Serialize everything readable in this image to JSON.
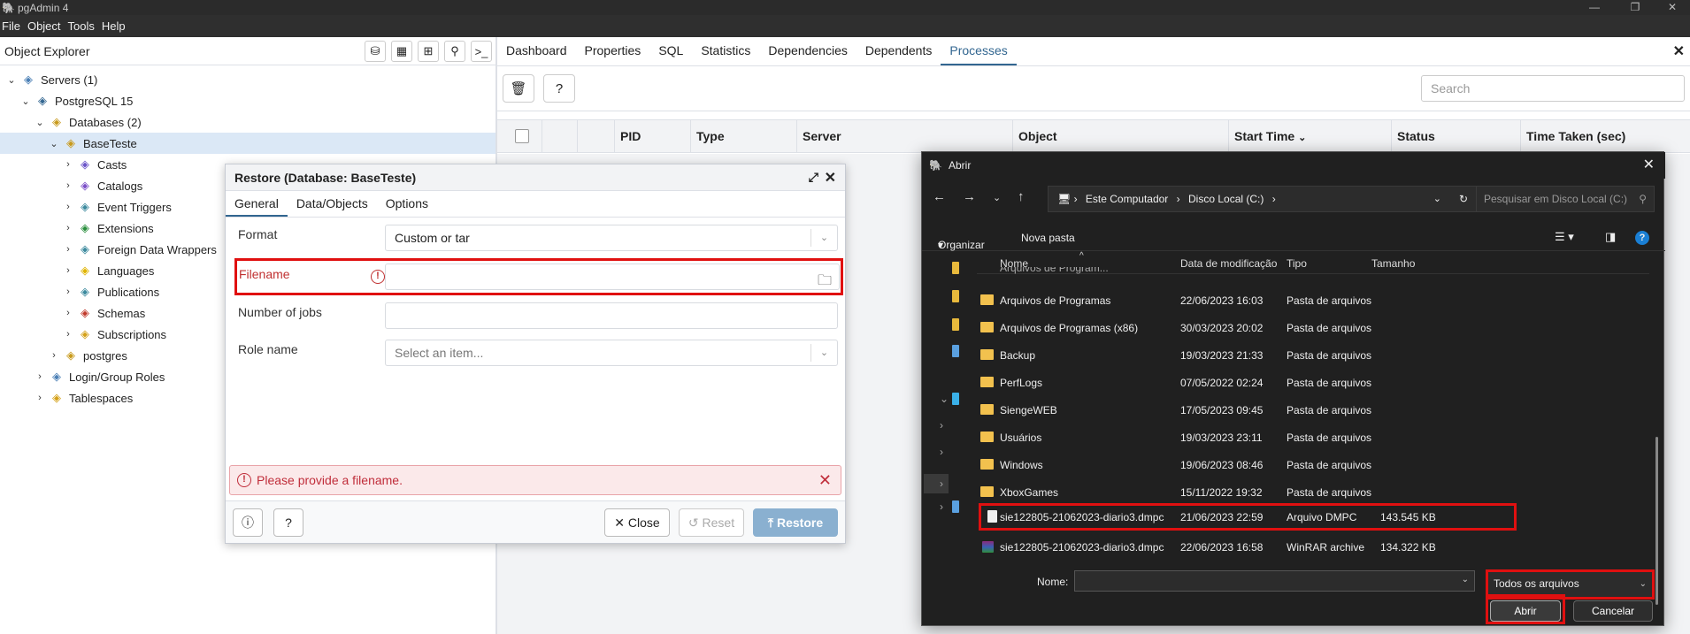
{
  "window": {
    "title": "pgAdmin 4",
    "controls": [
      "—",
      "❐",
      "✕"
    ]
  },
  "menu": [
    "File",
    "Object",
    "Tools",
    "Help"
  ],
  "object_explorer": {
    "title": "Object Explorer",
    "tree": [
      {
        "label": "Servers (1)",
        "indent": 0,
        "icon": "server-group-icon",
        "expanded": true
      },
      {
        "label": "PostgreSQL 15",
        "indent": 1,
        "icon": "postgresql-icon",
        "expanded": true
      },
      {
        "label": "Databases (2)",
        "indent": 2,
        "icon": "databases-icon",
        "expanded": true
      },
      {
        "label": "BaseTeste",
        "indent": 3,
        "icon": "database-icon",
        "expanded": true,
        "selected": true
      },
      {
        "label": "Casts",
        "indent": 4,
        "icon": "casts-icon"
      },
      {
        "label": "Catalogs",
        "indent": 4,
        "icon": "catalogs-icon"
      },
      {
        "label": "Event Triggers",
        "indent": 4,
        "icon": "event-triggers-icon"
      },
      {
        "label": "Extensions",
        "indent": 4,
        "icon": "extensions-icon"
      },
      {
        "label": "Foreign Data Wrappers",
        "indent": 4,
        "icon": "fdw-icon"
      },
      {
        "label": "Languages",
        "indent": 4,
        "icon": "languages-icon"
      },
      {
        "label": "Publications",
        "indent": 4,
        "icon": "publications-icon"
      },
      {
        "label": "Schemas",
        "indent": 4,
        "icon": "schemas-icon"
      },
      {
        "label": "Subscriptions",
        "indent": 4,
        "icon": "subscriptions-icon"
      },
      {
        "label": "postgres",
        "indent": 3,
        "icon": "database-icon"
      },
      {
        "label": "Login/Group Roles",
        "indent": 2,
        "icon": "roles-icon"
      },
      {
        "label": "Tablespaces",
        "indent": 2,
        "icon": "tablespaces-icon"
      }
    ]
  },
  "tabs": [
    "Dashboard",
    "Properties",
    "SQL",
    "Statistics",
    "Dependencies",
    "Dependents",
    "Processes"
  ],
  "active_tab": "Processes",
  "search_placeholder": "Search",
  "process_columns": [
    "PID",
    "Type",
    "Server",
    "Object",
    "Start Time",
    "Status",
    "Time Taken (sec)"
  ],
  "restore_dialog": {
    "title": "Restore (Database: BaseTeste)",
    "tabs": [
      "General",
      "Data/Objects",
      "Options"
    ],
    "fields": {
      "format_label": "Format",
      "format_value": "Custom or tar",
      "filename_label": "Filename",
      "filename_value": "",
      "jobs_label": "Number of jobs",
      "role_label": "Role name",
      "role_placeholder": "Select an item..."
    },
    "error": "Please provide a filename.",
    "buttons": {
      "close": "Close",
      "reset": "Reset",
      "restore": "Restore"
    }
  },
  "abrir_dialog": {
    "title": "Abrir",
    "breadcrumb": [
      "Este Computador",
      "Disco Local (C:)"
    ],
    "search_placeholder": "Pesquisar em Disco Local (C:)",
    "commands": {
      "organize": "Organizar",
      "new_folder": "Nova pasta"
    },
    "columns": [
      "Nome",
      "Data de modificação",
      "Tipo",
      "Tamanho"
    ],
    "partial_row": "Arquivos de Program...",
    "files": [
      {
        "name": "Arquivos de Programas",
        "date": "22/06/2023 16:03",
        "type": "Pasta de arquivos",
        "size": "",
        "kind": "folder"
      },
      {
        "name": "Arquivos de Programas (x86)",
        "date": "30/03/2023 20:02",
        "type": "Pasta de arquivos",
        "size": "",
        "kind": "folder"
      },
      {
        "name": "Backup",
        "date": "19/03/2023 21:33",
        "type": "Pasta de arquivos",
        "size": "",
        "kind": "folder"
      },
      {
        "name": "PerfLogs",
        "date": "07/05/2022 02:24",
        "type": "Pasta de arquivos",
        "size": "",
        "kind": "folder"
      },
      {
        "name": "SiengeWEB",
        "date": "17/05/2023 09:45",
        "type": "Pasta de arquivos",
        "size": "",
        "kind": "folder"
      },
      {
        "name": "Usuários",
        "date": "19/03/2023 23:11",
        "type": "Pasta de arquivos",
        "size": "",
        "kind": "folder"
      },
      {
        "name": "Windows",
        "date": "19/06/2023 08:46",
        "type": "Pasta de arquivos",
        "size": "",
        "kind": "folder"
      },
      {
        "name": "XboxGames",
        "date": "15/11/2022 19:32",
        "type": "Pasta de arquivos",
        "size": "",
        "kind": "folder"
      },
      {
        "name": "sie122805-21062023-diario3.dmpc",
        "date": "21/06/2023 22:59",
        "type": "Arquivo DMPC",
        "size": "143.545 KB",
        "kind": "file",
        "highlighted": true
      },
      {
        "name": "sie122805-21062023-diario3.dmpc",
        "date": "22/06/2023 16:58",
        "type": "WinRAR archive",
        "size": "134.322 KB",
        "kind": "rar"
      }
    ],
    "name_label": "Nome:",
    "name_value": "",
    "file_type": "Todos os arquivos",
    "buttons": {
      "open": "Abrir",
      "cancel": "Cancelar"
    }
  }
}
